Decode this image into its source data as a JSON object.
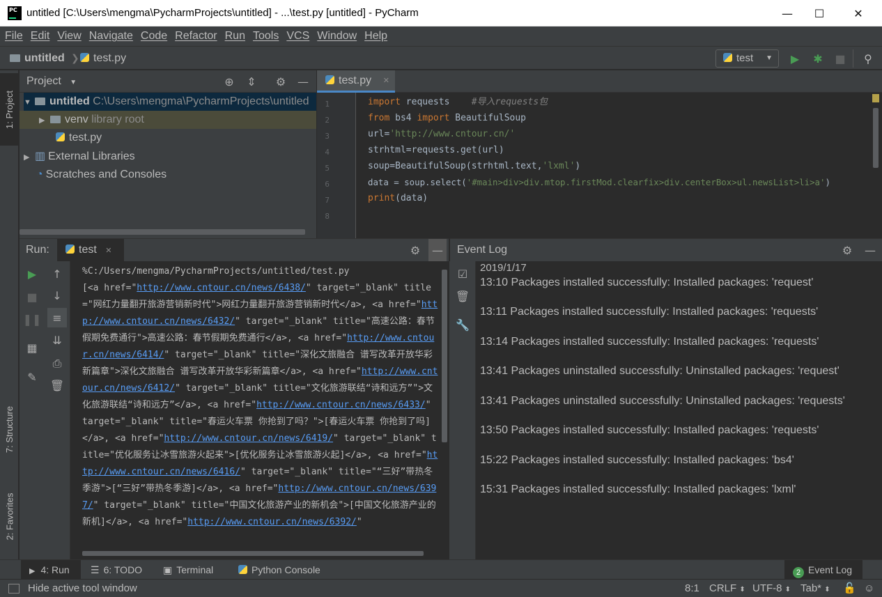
{
  "window": {
    "title": "untitled [C:\\Users\\mengma\\PycharmProjects\\untitled] - ...\\test.py [untitled] - PyCharm",
    "logo_text": "PC",
    "minimize": "—",
    "maximize": "☐",
    "close": "✕"
  },
  "menu": [
    "File",
    "Edit",
    "View",
    "Navigate",
    "Code",
    "Refactor",
    "Run",
    "Tools",
    "VCS",
    "Window",
    "Help"
  ],
  "navbar": {
    "project": "untitled",
    "file": "test.py",
    "run_config": "test"
  },
  "left_strip": {
    "project_tab": "1: Project",
    "structure_tab": "7: Structure",
    "favorites_tab": "2: Favorites"
  },
  "project_panel": {
    "title": "Project",
    "tree": [
      {
        "label": "untitled",
        "hint": "C:\\Users\\mengma\\PycharmProjects\\untitled"
      },
      {
        "label": "venv",
        "hint": "library root"
      },
      {
        "label": "test.py",
        "hint": ""
      },
      {
        "label": "External Libraries",
        "hint": ""
      },
      {
        "label": "Scratches and Consoles",
        "hint": ""
      }
    ]
  },
  "editor": {
    "tab_label": "test.py",
    "line_numbers": [
      "1",
      "2",
      "3",
      "4",
      "5",
      "6",
      "7",
      "8"
    ],
    "code": {
      "l1_kw": "import",
      "l1_mod": " requests",
      "l1_cmt": "#导入requests包",
      "l2_kw1": "from",
      "l2_mod": " bs4 ",
      "l2_kw2": "import",
      "l2_name": " BeautifulSoup",
      "l3_var": "url=",
      "l3_str": "'http://www.cntour.cn/'",
      "l4": "strhtml=requests.get(url)",
      "l5_a": "soup=BeautifulSoup(strhtml.text,",
      "l5_str": "'lxml'",
      "l5_b": ")",
      "l6_a": "data = soup.select(",
      "l6_str": "'#main>div>div.mtop.firstMod.clearfix>div.centerBox>ul.newsList>li>a'",
      "l6_b": ")",
      "l7_kw": "print",
      "l7_b": "(data)"
    }
  },
  "run_panel": {
    "label": "Run:",
    "tab": "test",
    "console": [
      {
        "t": "text",
        "v": "%C:/Users/mengma/PycharmProjects/untitled/test.py\n[<a href=\""
      },
      {
        "t": "link",
        "v": "http://www.cntour.cn/news/6438/"
      },
      {
        "t": "text",
        "v": "\" target=\"_blank\" title=\"网红力量翻开旅游营销新时代\">网红力量翻开旅游营销新时代</a>, <a href=\""
      },
      {
        "t": "link",
        "v": "http://www.cntour.cn/news/6432/"
      },
      {
        "t": "text",
        "v": "\" target=\"_blank\" title=\"高速公路：春节假期免费通行\">高速公路：春节假期免费通行</a>, <a href=\""
      },
      {
        "t": "link",
        "v": "http://www.cntour.cn/news/6414/"
      },
      {
        "t": "text",
        "v": "\" target=\"_blank\" title=\"深化文旅融合 谱写改革开放华彩新篇章\">深化文旅融合 谱写改革开放华彩新篇章</a>, <a href=\""
      },
      {
        "t": "link",
        "v": "http://www.cntour.cn/news/6412/"
      },
      {
        "t": "text",
        "v": "\" target=\"_blank\" title=\"文化旅游联结“诗和远方”\">文化旅游联结“诗和远方”</a>, <a href=\""
      },
      {
        "t": "link",
        "v": "http://www.cntour.cn/news/6433/"
      },
      {
        "t": "text",
        "v": "\" target=\"_blank\" title=\"春运火车票 你抢到了吗？\">[春运火车票 你抢到了吗]</a>, <a href=\""
      },
      {
        "t": "link",
        "v": "http://www.cntour.cn/news/6419/"
      },
      {
        "t": "text",
        "v": "\" target=\"_blank\" title=\"优化服务让冰雪旅游火起来\">[优化服务让冰雪旅游火起]</a>, <a href=\""
      },
      {
        "t": "link",
        "v": "http://www.cntour.cn/news/6416/"
      },
      {
        "t": "text",
        "v": "\" target=\"_blank\" title=\"“三好”带热冬季游\">[“三好”带热冬季游]</a>, <a href=\""
      },
      {
        "t": "link",
        "v": "http://www.cntour.cn/news/6397/"
      },
      {
        "t": "text",
        "v": "\" target=\"_blank\" title=\"中国文化旅游产业的新机会\">[中国文化旅游产业的新机]</a>, <a href=\""
      },
      {
        "t": "link",
        "v": "http://www.cntour.cn/news/6392/"
      },
      {
        "t": "text",
        "v": "\""
      }
    ]
  },
  "event_log": {
    "title": "Event Log",
    "date": "2019/1/17",
    "entries": [
      "13:10 Packages installed successfully: Installed packages: 'request'",
      "13:11 Packages installed successfully: Installed packages: 'requests'",
      "13:14 Packages installed successfully: Installed packages: 'requests'",
      "13:41 Packages uninstalled successfully: Uninstalled packages: 'request'",
      "13:41 Packages uninstalled successfully: Uninstalled packages: 'requests'",
      "13:50 Packages installed successfully: Installed packages: 'requests'",
      "15:22 Packages installed successfully: Installed packages: 'bs4'",
      "15:31 Packages installed successfully: Installed packages: 'lxml'"
    ]
  },
  "bottom_tabs": {
    "run": "4: Run",
    "todo": "6: TODO",
    "terminal": "Terminal",
    "python_console": "Python Console",
    "event_log": "Event Log",
    "event_log_badge": "2"
  },
  "status_bar": {
    "message": "Hide active tool window",
    "position": "8:1",
    "line_sep": "CRLF",
    "encoding": "UTF-8",
    "indent": "Tab*"
  },
  "colors": {
    "accent": "#4a88c7",
    "run_green": "#499c54",
    "link_blue": "#589df6",
    "keyword": "#cc7832",
    "string": "#6a8759"
  }
}
